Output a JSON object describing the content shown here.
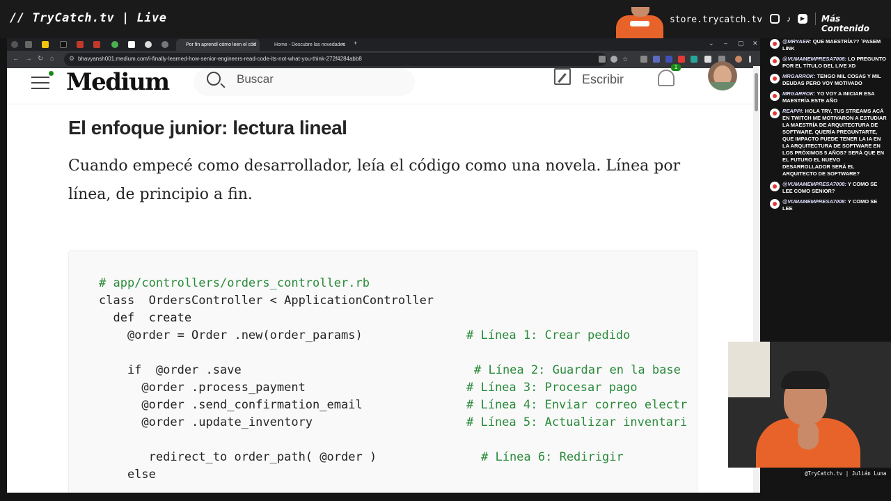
{
  "stream": {
    "brand": "// TryCatch.tv | Live",
    "store": "store.trycatch.tv",
    "more": "Más Contenido",
    "webcam_caption": "@TryCatch.tv | Julián Luna"
  },
  "browser": {
    "tabs": [
      {
        "label": "Por fin aprendí cómo leen el cód"
      },
      {
        "label": "Home - Descubre las novedades"
      }
    ],
    "url": "bhavyansh001.medium.com/i-finally-learned-how-senior-engineers-read-code-its-not-what-you-think-272f4284abb8"
  },
  "medium": {
    "logo": "Medium",
    "search_placeholder": "Buscar",
    "write_label": "Escribir",
    "notification_count": "1"
  },
  "article": {
    "heading": "El enfoque junior: lectura lineal",
    "paragraph": "Cuando empecé como desarrollador, leía el código como una novela. Línea por línea, de principio a fin."
  },
  "code": {
    "lines": [
      {
        "text": "# app/controllers/orders_controller.rb"
      },
      {
        "text": "class  OrdersController < ApplicationController"
      },
      {
        "text": "  def  create"
      },
      {
        "text": "    @order = Order .new(order_params)",
        "comment": "# Línea 1: Crear pedido"
      },
      {
        "text": "    if  @order .save",
        "comment": "# Línea 2: Guardar en la base"
      },
      {
        "text": "      @order .process_payment",
        "comment": "# Línea 3: Procesar pago"
      },
      {
        "text": "      @order .send_confirmation_email",
        "comment": "# Línea 4: Enviar correo electr"
      },
      {
        "text": "      @order .update_inventory",
        "comment": "# Línea 5: Actualizar inventari"
      },
      {
        "text": "       redirect_to order_path( @order )",
        "comment": "# Línea 6: Redirigir"
      },
      {
        "text": "    else"
      }
    ]
  },
  "chat": [
    {
      "user": "@mryaer:",
      "text": "que maestría?? ´pasem link"
    },
    {
      "user": "@vumamempresa7008:",
      "text": "lo pregunto por el título del live xd"
    },
    {
      "user": "mrgarrok:",
      "text": "tengo mil cosas y mil deudas pero voy motivado"
    },
    {
      "user": "mrgarrok:",
      "text": "yo voy a iniciar esa maestría este año"
    },
    {
      "user": "reappi:",
      "text": "Hola try, tus streams acá en twitch me motivaron a estudiar la maestría de arquitectura de software. Quería preguntarte, que impacto puede tener la IA en la arquitectura de software en los próximos 5 años? Será que en el futuro el nuevo desarrollador será el arquitecto de software?"
    },
    {
      "user": "@vumamempresa7008:",
      "text": "y como se lee como senior?"
    },
    {
      "user": "@vumamempresa7008:",
      "text": "y como se lee"
    }
  ]
}
